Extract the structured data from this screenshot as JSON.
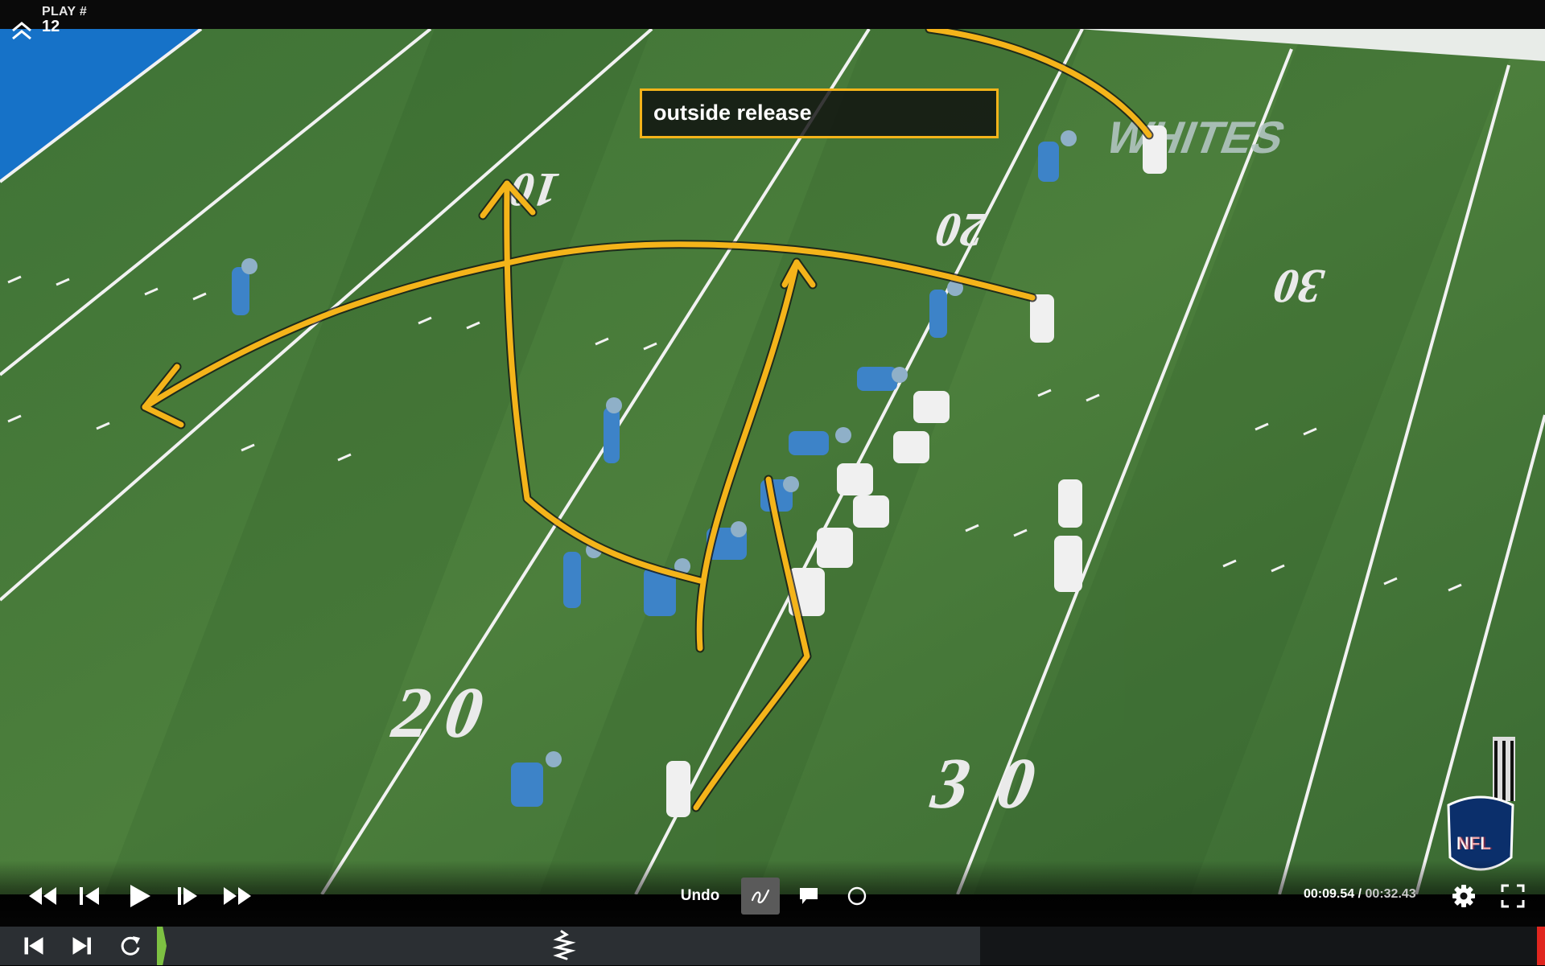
{
  "header": {
    "play_label": "PLAY #",
    "play_number": "12",
    "collapse_icon": "chevron-double-up-icon"
  },
  "annotation": {
    "text": "outside release",
    "color": "#f4b41a"
  },
  "field": {
    "yard_numbers_far": [
      "10",
      "20",
      "30"
    ],
    "yard_numbers_near": [
      "20",
      "30"
    ],
    "endzone_text": "WHITES",
    "field_color": "#4a7a3a"
  },
  "controls": {
    "undo_label": "Undo",
    "current_time": "00:09.54",
    "separator": " / ",
    "total_time": "00:32.43",
    "progress_percent": 29.4,
    "tools": [
      "pen-icon",
      "comment-icon",
      "circle-icon"
    ]
  },
  "timeline": {
    "icons": [
      "skip-back-icon",
      "skip-forward-icon",
      "replay-icon",
      "app-logo-icon"
    ]
  }
}
